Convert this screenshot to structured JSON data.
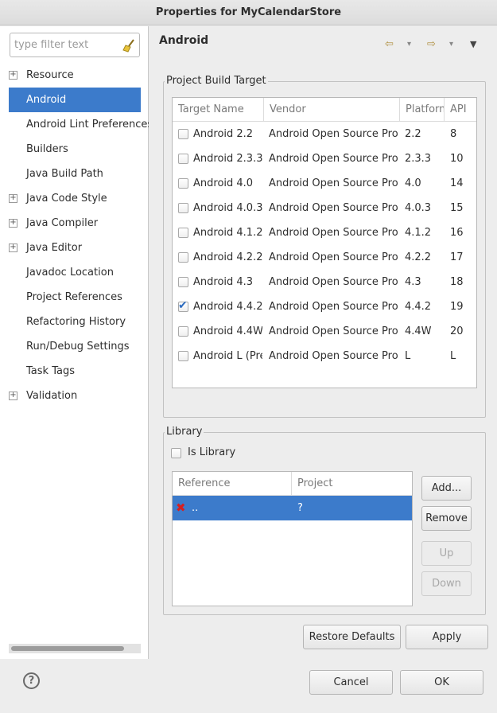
{
  "window": {
    "title": "Properties for MyCalendarStore"
  },
  "filter": {
    "placeholder": "type filter text",
    "icon": "broom-icon"
  },
  "sidebar": {
    "items": [
      {
        "label": "Resource",
        "expandable": true,
        "selected": false
      },
      {
        "label": "Android",
        "expandable": false,
        "selected": true
      },
      {
        "label": "Android Lint Preferences",
        "expandable": false,
        "selected": false
      },
      {
        "label": "Builders",
        "expandable": false,
        "selected": false
      },
      {
        "label": "Java Build Path",
        "expandable": false,
        "selected": false
      },
      {
        "label": "Java Code Style",
        "expandable": true,
        "selected": false
      },
      {
        "label": "Java Compiler",
        "expandable": true,
        "selected": false
      },
      {
        "label": "Java Editor",
        "expandable": true,
        "selected": false
      },
      {
        "label": "Javadoc Location",
        "expandable": false,
        "selected": false
      },
      {
        "label": "Project References",
        "expandable": false,
        "selected": false
      },
      {
        "label": "Refactoring History",
        "expandable": false,
        "selected": false
      },
      {
        "label": "Run/Debug Settings",
        "expandable": false,
        "selected": false
      },
      {
        "label": "Task Tags",
        "expandable": false,
        "selected": false
      },
      {
        "label": "Validation",
        "expandable": true,
        "selected": false
      }
    ]
  },
  "page": {
    "title": "Android"
  },
  "build_target": {
    "group_label": "Project Build Target",
    "columns": [
      "Target Name",
      "Vendor",
      "Platform",
      "API"
    ],
    "rows": [
      {
        "name": "Android 2.2",
        "vendor": "Android Open Source Project",
        "platform": "2.2",
        "api": "8",
        "checked": false
      },
      {
        "name": "Android 2.3.3",
        "vendor": "Android Open Source Project",
        "platform": "2.3.3",
        "api": "10",
        "checked": false
      },
      {
        "name": "Android 4.0",
        "vendor": "Android Open Source Project",
        "platform": "4.0",
        "api": "14",
        "checked": false
      },
      {
        "name": "Android 4.0.3",
        "vendor": "Android Open Source Project",
        "platform": "4.0.3",
        "api": "15",
        "checked": false
      },
      {
        "name": "Android 4.1.2",
        "vendor": "Android Open Source Project",
        "platform": "4.1.2",
        "api": "16",
        "checked": false
      },
      {
        "name": "Android 4.2.2",
        "vendor": "Android Open Source Project",
        "platform": "4.2.2",
        "api": "17",
        "checked": false
      },
      {
        "name": "Android 4.3",
        "vendor": "Android Open Source Project",
        "platform": "4.3",
        "api": "18",
        "checked": false
      },
      {
        "name": "Android 4.4.2",
        "vendor": "Android Open Source Project",
        "platform": "4.4.2",
        "api": "19",
        "checked": true
      },
      {
        "name": "Android 4.4W",
        "vendor": "Android Open Source Project",
        "platform": "4.4W",
        "api": "20",
        "checked": false
      },
      {
        "name": "Android L (Preview)",
        "vendor": "Android Open Source Project",
        "platform": "L",
        "api": "L",
        "checked": false
      }
    ]
  },
  "library": {
    "group_label": "Library",
    "is_library_label": "Is Library",
    "is_library_checked": false,
    "columns": [
      "Reference",
      "Project"
    ],
    "rows": [
      {
        "reference": "..",
        "project": "?",
        "error": true,
        "selected": true
      }
    ],
    "buttons": {
      "add": "Add...",
      "remove": "Remove",
      "up": "Up",
      "down": "Down"
    }
  },
  "actions": {
    "restore_defaults": "Restore Defaults",
    "apply": "Apply"
  },
  "footer": {
    "cancel": "Cancel",
    "ok": "OK",
    "help_icon": "help-icon"
  },
  "colors": {
    "selection": "#3c7bcb",
    "error": "#d62020"
  }
}
